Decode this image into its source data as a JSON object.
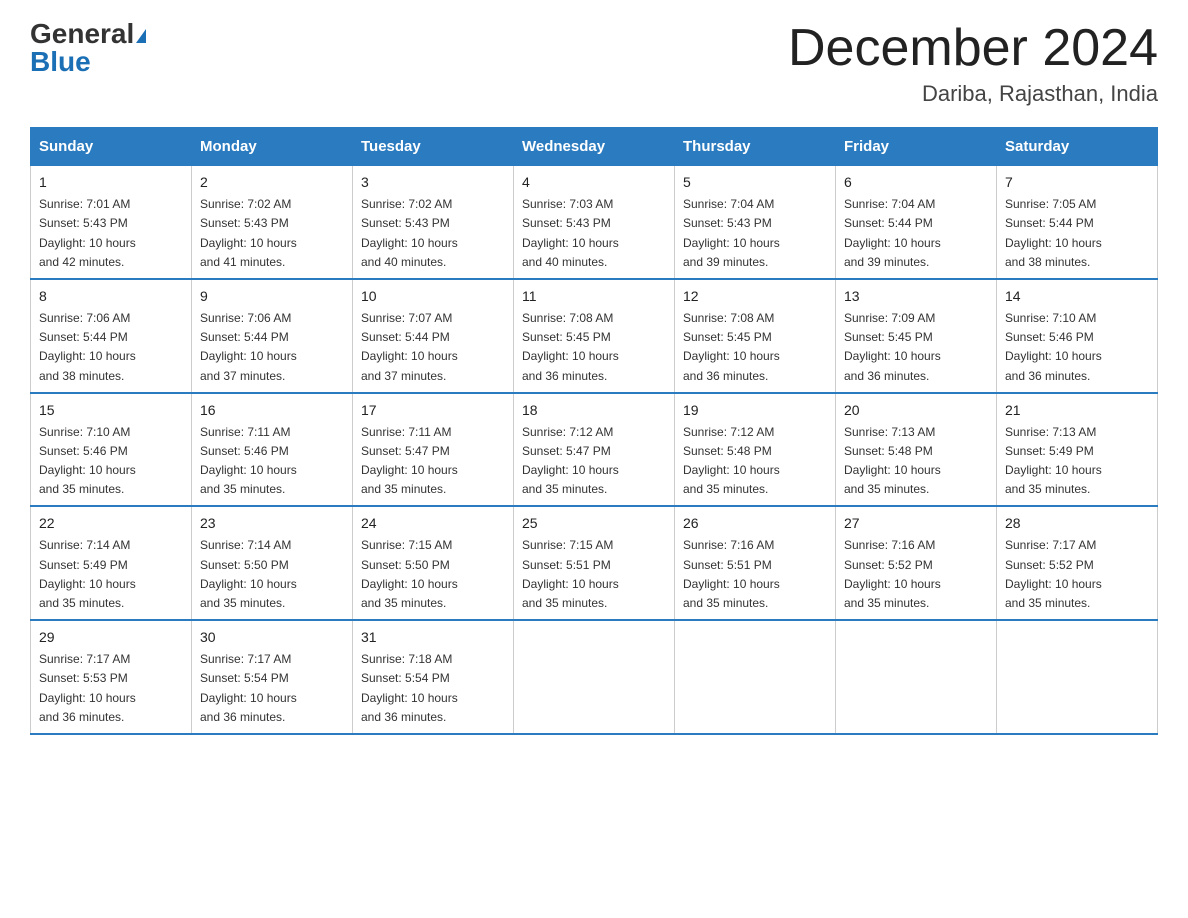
{
  "header": {
    "logo_general": "General",
    "logo_blue": "Blue",
    "month_title": "December 2024",
    "location": "Dariba, Rajasthan, India"
  },
  "days_of_week": [
    "Sunday",
    "Monday",
    "Tuesday",
    "Wednesday",
    "Thursday",
    "Friday",
    "Saturday"
  ],
  "weeks": [
    [
      {
        "day": "1",
        "sunrise": "7:01 AM",
        "sunset": "5:43 PM",
        "daylight": "10 hours and 42 minutes."
      },
      {
        "day": "2",
        "sunrise": "7:02 AM",
        "sunset": "5:43 PM",
        "daylight": "10 hours and 41 minutes."
      },
      {
        "day": "3",
        "sunrise": "7:02 AM",
        "sunset": "5:43 PM",
        "daylight": "10 hours and 40 minutes."
      },
      {
        "day": "4",
        "sunrise": "7:03 AM",
        "sunset": "5:43 PM",
        "daylight": "10 hours and 40 minutes."
      },
      {
        "day": "5",
        "sunrise": "7:04 AM",
        "sunset": "5:43 PM",
        "daylight": "10 hours and 39 minutes."
      },
      {
        "day": "6",
        "sunrise": "7:04 AM",
        "sunset": "5:44 PM",
        "daylight": "10 hours and 39 minutes."
      },
      {
        "day": "7",
        "sunrise": "7:05 AM",
        "sunset": "5:44 PM",
        "daylight": "10 hours and 38 minutes."
      }
    ],
    [
      {
        "day": "8",
        "sunrise": "7:06 AM",
        "sunset": "5:44 PM",
        "daylight": "10 hours and 38 minutes."
      },
      {
        "day": "9",
        "sunrise": "7:06 AM",
        "sunset": "5:44 PM",
        "daylight": "10 hours and 37 minutes."
      },
      {
        "day": "10",
        "sunrise": "7:07 AM",
        "sunset": "5:44 PM",
        "daylight": "10 hours and 37 minutes."
      },
      {
        "day": "11",
        "sunrise": "7:08 AM",
        "sunset": "5:45 PM",
        "daylight": "10 hours and 36 minutes."
      },
      {
        "day": "12",
        "sunrise": "7:08 AM",
        "sunset": "5:45 PM",
        "daylight": "10 hours and 36 minutes."
      },
      {
        "day": "13",
        "sunrise": "7:09 AM",
        "sunset": "5:45 PM",
        "daylight": "10 hours and 36 minutes."
      },
      {
        "day": "14",
        "sunrise": "7:10 AM",
        "sunset": "5:46 PM",
        "daylight": "10 hours and 36 minutes."
      }
    ],
    [
      {
        "day": "15",
        "sunrise": "7:10 AM",
        "sunset": "5:46 PM",
        "daylight": "10 hours and 35 minutes."
      },
      {
        "day": "16",
        "sunrise": "7:11 AM",
        "sunset": "5:46 PM",
        "daylight": "10 hours and 35 minutes."
      },
      {
        "day": "17",
        "sunrise": "7:11 AM",
        "sunset": "5:47 PM",
        "daylight": "10 hours and 35 minutes."
      },
      {
        "day": "18",
        "sunrise": "7:12 AM",
        "sunset": "5:47 PM",
        "daylight": "10 hours and 35 minutes."
      },
      {
        "day": "19",
        "sunrise": "7:12 AM",
        "sunset": "5:48 PM",
        "daylight": "10 hours and 35 minutes."
      },
      {
        "day": "20",
        "sunrise": "7:13 AM",
        "sunset": "5:48 PM",
        "daylight": "10 hours and 35 minutes."
      },
      {
        "day": "21",
        "sunrise": "7:13 AM",
        "sunset": "5:49 PM",
        "daylight": "10 hours and 35 minutes."
      }
    ],
    [
      {
        "day": "22",
        "sunrise": "7:14 AM",
        "sunset": "5:49 PM",
        "daylight": "10 hours and 35 minutes."
      },
      {
        "day": "23",
        "sunrise": "7:14 AM",
        "sunset": "5:50 PM",
        "daylight": "10 hours and 35 minutes."
      },
      {
        "day": "24",
        "sunrise": "7:15 AM",
        "sunset": "5:50 PM",
        "daylight": "10 hours and 35 minutes."
      },
      {
        "day": "25",
        "sunrise": "7:15 AM",
        "sunset": "5:51 PM",
        "daylight": "10 hours and 35 minutes."
      },
      {
        "day": "26",
        "sunrise": "7:16 AM",
        "sunset": "5:51 PM",
        "daylight": "10 hours and 35 minutes."
      },
      {
        "day": "27",
        "sunrise": "7:16 AM",
        "sunset": "5:52 PM",
        "daylight": "10 hours and 35 minutes."
      },
      {
        "day": "28",
        "sunrise": "7:17 AM",
        "sunset": "5:52 PM",
        "daylight": "10 hours and 35 minutes."
      }
    ],
    [
      {
        "day": "29",
        "sunrise": "7:17 AM",
        "sunset": "5:53 PM",
        "daylight": "10 hours and 36 minutes."
      },
      {
        "day": "30",
        "sunrise": "7:17 AM",
        "sunset": "5:54 PM",
        "daylight": "10 hours and 36 minutes."
      },
      {
        "day": "31",
        "sunrise": "7:18 AM",
        "sunset": "5:54 PM",
        "daylight": "10 hours and 36 minutes."
      },
      null,
      null,
      null,
      null
    ]
  ],
  "labels": {
    "sunrise_label": "Sunrise:",
    "sunset_label": "Sunset:",
    "daylight_label": "Daylight:"
  }
}
